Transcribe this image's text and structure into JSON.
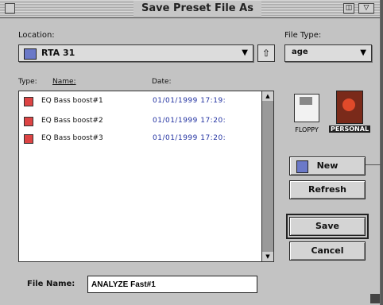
{
  "window": {
    "title": "Save Preset File As",
    "zoom_glyph": "◫",
    "collapse_glyph": "▽"
  },
  "location": {
    "label": "Location:",
    "value": "RTA 31",
    "arrow": "▼",
    "up_glyph": "⇧"
  },
  "file_type": {
    "label": "File Type:",
    "value": "age",
    "arrow": "▼"
  },
  "columns": {
    "type": "Type:",
    "name": "Name:",
    "date": "Date:"
  },
  "files": [
    {
      "name": "EQ Bass boost#1",
      "date": "01/01/1999  17:19:"
    },
    {
      "name": "EQ Bass boost#2",
      "date": "01/01/1999  17:20:"
    },
    {
      "name": "EQ Bass boost#3",
      "date": "01/01/1999  17:20:"
    }
  ],
  "scroll": {
    "up": "▲",
    "down": "▼"
  },
  "drives": {
    "floppy": "FLOPPY",
    "hd": "PERSONAL"
  },
  "buttons": {
    "new": "New",
    "refresh": "Refresh",
    "save": "Save",
    "cancel": "Cancel"
  },
  "file_name": {
    "label": "File Name:",
    "value": "ANALYZE Fast#1"
  }
}
